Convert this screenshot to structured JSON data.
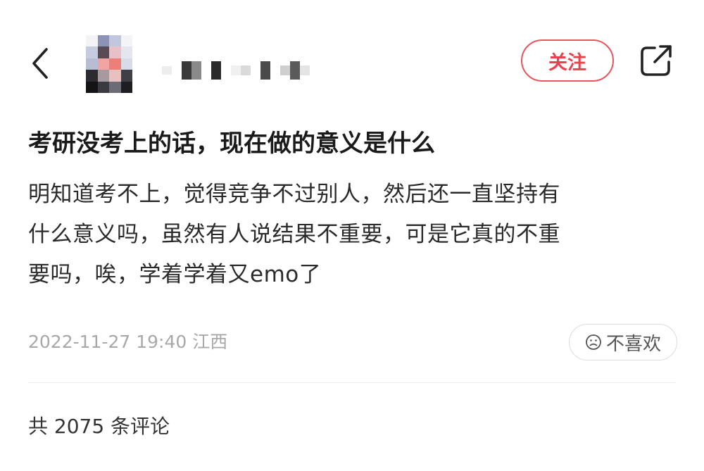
{
  "header": {
    "back_icon": "chevron-left-icon",
    "follow_label": "关注",
    "share_icon": "share-external-icon",
    "accent_color": "#e8424f"
  },
  "post": {
    "title": "考研没考上的话，现在做的意义是什么",
    "content_lines": [
      "明知道考不上，觉得竞争不过别人，然后还一直坚持有",
      "什么意义吗，虽然有人说结果不重要，可是它真的不重",
      "要吗，唉，学着学着又emo了"
    ],
    "timestamp": "2022-11-27 19:40",
    "location": "江西",
    "dislike_label": "不喜欢",
    "dislike_icon": "frown-face-icon"
  },
  "comments": {
    "summary": "共 2075 条评论"
  }
}
